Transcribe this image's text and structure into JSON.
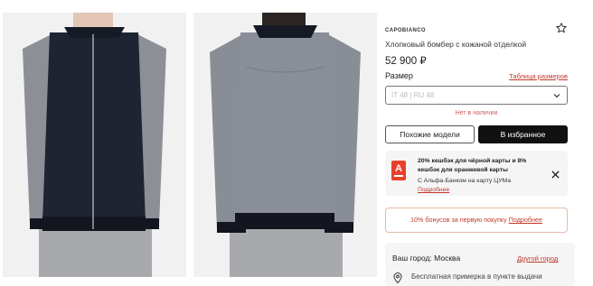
{
  "product": {
    "brand": "CAPOBIANCO",
    "title": "Хлопковый бомбер с кожаной отделкой",
    "price": "52 900 ₽"
  },
  "size": {
    "label": "Размер",
    "table_link": "Таблица размеров",
    "selected": "IT 48 | RU 48",
    "stock_status": "Нет в наличии"
  },
  "buttons": {
    "similar": "Похожие модели",
    "favorites": "В избранное"
  },
  "promo": {
    "logo_letter": "А",
    "title": "20% кешбэк для чёрной карты и 8% кешбэк для оранжевой карты",
    "subtitle": "С Альфа-Банком на карту ЦУМа",
    "more_link": "Подробнее"
  },
  "bonus": {
    "text": "10% бонусов за первую покупку",
    "link": "Подробнее"
  },
  "delivery": {
    "city": "Ваш город: Москва",
    "other_city_link": "Другой город",
    "fitting": "Бесплатная примерка в пункте выдачи"
  },
  "colors": {
    "accent": "#c0392b",
    "dark_button": "#111111",
    "alfa_red": "#e8412b"
  },
  "icons": {
    "favorite": "star-outline-icon",
    "chevron": "chevron-down-icon",
    "close": "close-icon",
    "location": "map-pin-icon"
  }
}
